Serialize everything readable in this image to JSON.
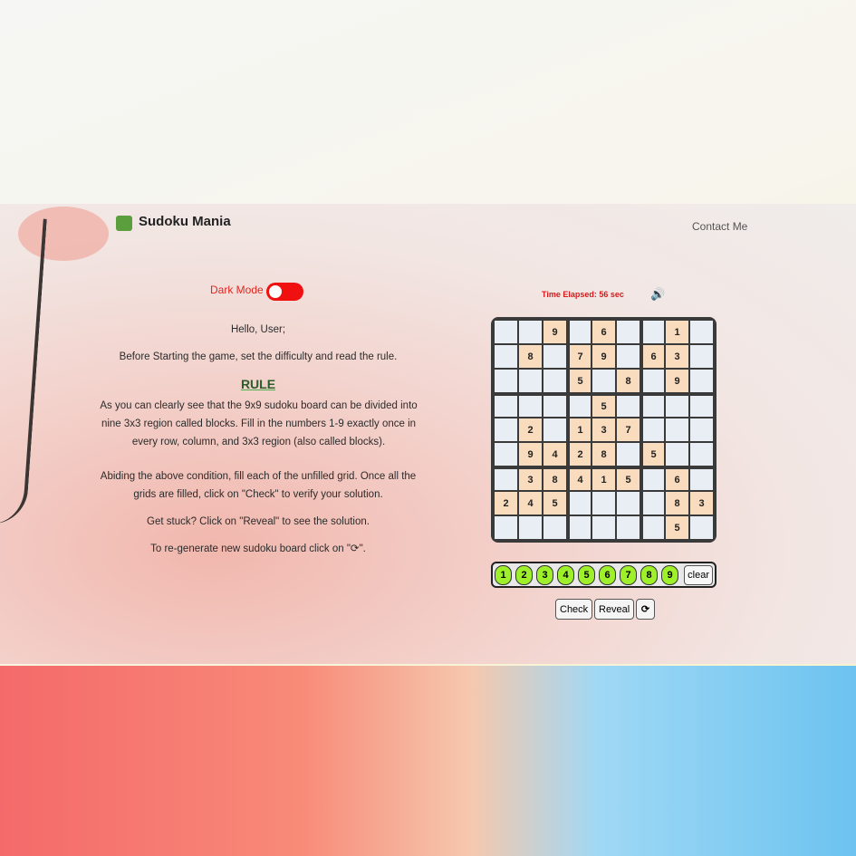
{
  "header": {
    "title": "Sudoku Mania",
    "contact": "Contact Me"
  },
  "dark_mode": {
    "label": "Dark Mode",
    "enabled": false
  },
  "intro": {
    "greeting": "Hello, User;",
    "instruction": "Before Starting the game, set the difficulty and read the rule.",
    "rule_heading": "RULE",
    "rule_text": "As you can clearly see that the 9x9 sudoku board can be divided into nine 3x3 region called blocks. Fill in the numbers 1-9 exactly once in every row, column, and 3x3 region (also called blocks).",
    "condition_text": "Abiding the above condition, fill each of the unfilled grid. Once all the grids are filled, click on \"Check\" to verify your solution.",
    "stuck_text": "Get stuck? Click on \"Reveal\" to see the solution.",
    "regen_text": "To re-generate new sudoku board click on \"⟳\"."
  },
  "timer": {
    "text": "Time Elapsed: 56 sec"
  },
  "icons": {
    "logo": "green-square",
    "speaker": "speaker-icon",
    "refresh": "refresh-icon"
  },
  "board": [
    [
      "",
      "",
      "9",
      "",
      "6",
      "",
      "",
      "1",
      ""
    ],
    [
      "",
      "8",
      "",
      "7",
      "9",
      "",
      "6",
      "3",
      ""
    ],
    [
      "",
      "",
      "",
      "5",
      "",
      "8",
      "",
      "9",
      ""
    ],
    [
      "",
      "",
      "",
      "",
      "5",
      "",
      "",
      "",
      ""
    ],
    [
      "",
      "2",
      "",
      "1",
      "3",
      "7",
      "",
      "",
      ""
    ],
    [
      "",
      "9",
      "4",
      "2",
      "8",
      "",
      "5",
      "",
      ""
    ],
    [
      "",
      "3",
      "8",
      "4",
      "1",
      "5",
      "",
      "6",
      ""
    ],
    [
      "2",
      "4",
      "5",
      "",
      "",
      "",
      "",
      "8",
      "3"
    ],
    [
      "",
      "",
      "",
      "",
      "",
      "",
      "",
      "5",
      ""
    ]
  ],
  "number_pad": [
    "1",
    "2",
    "3",
    "4",
    "5",
    "6",
    "7",
    "8",
    "9"
  ],
  "buttons": {
    "clear": "clear",
    "check": "Check",
    "reveal": "Reveal",
    "refresh": "⟳"
  },
  "colors": {
    "given_cell": "#f9dcbd",
    "empty_cell": "#e9eef5",
    "pad": "#9ef02a",
    "toggle": "#f01010"
  }
}
